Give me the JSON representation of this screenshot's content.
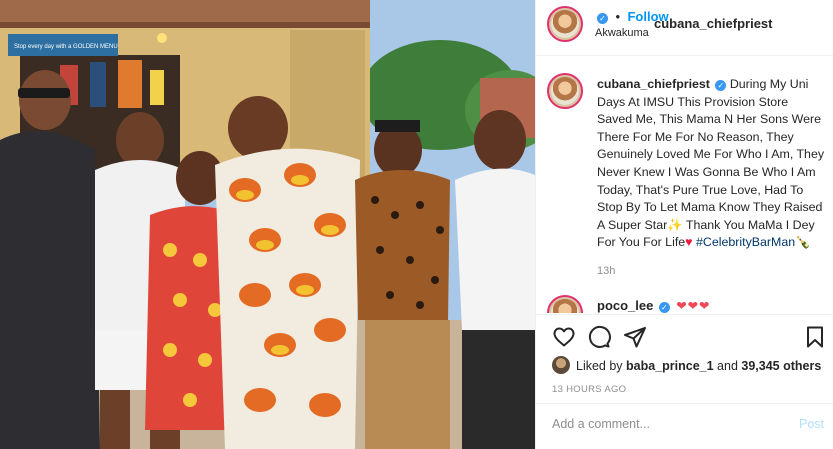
{
  "post": {
    "username": "cubana_chiefpriest",
    "follow_label": "Follow",
    "separator": "•",
    "location": "Akwakuma",
    "caption_text": "During My Uni Days At IMSU This Provision Store Saved Me, This Mama N Her Sons Were There For Me For No Reason, They Genuinely Loved Me For Who I Am, They Never Knew I Was Gonna Be Who I Am Today, That's Pure True Love, Had To Stop By To Let Mama Know They Raised A Super Star",
    "caption_star": "✨",
    "caption_text2": "Thank You MaMa I Dey For You For Life",
    "caption_heart": "♥",
    "hashtag": "#CelebrityBarMan",
    "caption_end_emoji": "🍾",
    "time_ago": "13h",
    "photo_sign_text": "Stop every day with a GOLDEN MENU"
  },
  "reply": {
    "username": "poco_lee",
    "hearts": "❤❤❤"
  },
  "actions": {
    "icons": [
      "heart-icon",
      "comment-icon",
      "share-icon",
      "bookmark-icon"
    ],
    "liked_by_prefix": "Liked by ",
    "liked_by_user": "baba_prince_1",
    "liked_by_mid": " and ",
    "likes_count": "39,345 others",
    "posted_ago": "13 HOURS AGO"
  },
  "comment_box": {
    "placeholder": "Add a comment...",
    "post_label": "Post"
  },
  "colors": {
    "follow": "#0095f6",
    "verified": "#3897f0",
    "hashtag": "#00376b",
    "post_disabled": "#b2dffc"
  }
}
